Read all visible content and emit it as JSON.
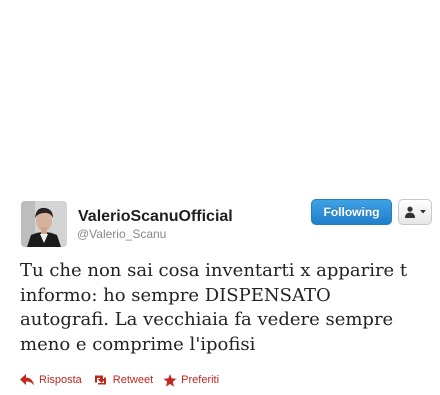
{
  "tweet": {
    "display_name": "ValerioScanuOfficial",
    "screen_name": "@Valerio_Scanu",
    "text_lines": [
      "Tu che non sai cosa inventarti x apparire t",
      "informo: ho sempre DISPENSATO",
      "autografi. La vecchiaia fa vedere sempre",
      "meno e comprime l'ipofisi"
    ]
  },
  "buttons": {
    "follow_label": "Following"
  },
  "actions": [
    {
      "label": "Risposta",
      "icon": "reply-arrow-icon"
    },
    {
      "label": "Retweet",
      "icon": "retweet-icon"
    },
    {
      "label": "Preferiti",
      "icon": "star-icon"
    }
  ],
  "colors": {
    "follow_button": "#2b8fd6",
    "action_links": "#c0281e",
    "display_name": "#1f1f1f",
    "screen_name": "#888888"
  }
}
